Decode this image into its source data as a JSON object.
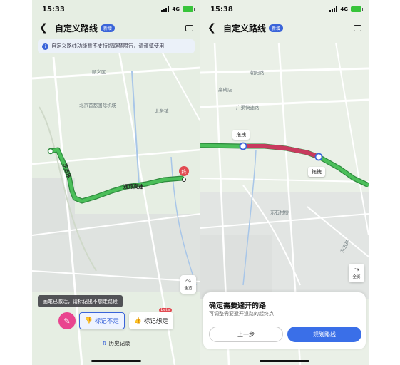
{
  "left": {
    "status": {
      "time": "15:33",
      "network": "4G"
    },
    "nav": {
      "title": "自定义路线",
      "badge": "新增"
    },
    "notice": "自定义路线功能暂不支持规避禁限行，请谨慎使用",
    "map_labels": [
      "顺义区",
      "北京首都国际机场",
      "北务镇",
      "通燕高速",
      "东五环",
      "终"
    ],
    "fullview": "全览",
    "tooltip": "画笔已激活，请标记出不想走路段",
    "buttons": {
      "avoid": "标记不走",
      "want": "标记想走",
      "beta": "beta"
    },
    "history": "历史记录"
  },
  "right": {
    "status": {
      "time": "15:38",
      "network": "4G"
    },
    "nav": {
      "title": "自定义路线",
      "badge": "新增"
    },
    "map_labels": [
      "朝阳路",
      "高碑店",
      "广渠快速路",
      "东石村桥",
      "东五环"
    ],
    "drag_labels": [
      "拖拽",
      "拖拽"
    ],
    "fullview": "全览",
    "sheet": {
      "title": "确定需要避开的路",
      "subtitle": "可调整需要避开道路的起终点",
      "prev": "上一步",
      "plan": "规划路线"
    }
  },
  "colors": {
    "route_green": "#36a94a",
    "route_red": "#c83a5e",
    "accent_blue": "#3a64d9",
    "pen_pink": "#e9458f",
    "end_marker": "#e24b52"
  }
}
